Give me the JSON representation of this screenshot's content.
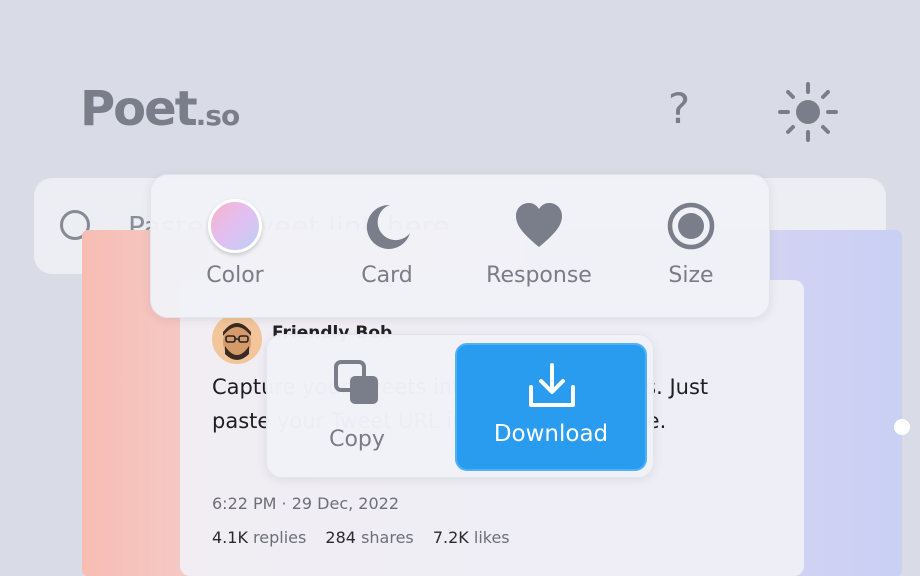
{
  "header": {
    "logo_main": "Poet",
    "logo_domain": ".so",
    "help_icon": "?",
    "theme_icon": "sun-icon"
  },
  "search": {
    "placeholder": "Paste a Tweet link here",
    "icon": "search-circle-icon"
  },
  "toolbar": {
    "items": [
      {
        "label": "Color",
        "icon": "color-swatch-icon"
      },
      {
        "label": "Card",
        "icon": "moon-icon"
      },
      {
        "label": "Response",
        "icon": "heart-icon"
      },
      {
        "label": "Size",
        "icon": "radio-target-icon"
      }
    ]
  },
  "export": {
    "copy_label": "Copy",
    "download_label": "Download"
  },
  "tweet": {
    "author": "Friendly Bob",
    "text": "Capture your tweets into beautiful images. Just paste your Tweet URL into the input above.",
    "time": "6:22 PM · 29 Dec, 2022",
    "stats": {
      "replies_count": "4.1K",
      "replies_label": "replies",
      "shares_count": "284",
      "shares_label": "shares",
      "likes_count": "7.2K",
      "likes_label": "likes"
    }
  },
  "colors": {
    "accent": "#2a9cf0",
    "background": "#d9dce6",
    "icon": "#7a7e8a"
  }
}
